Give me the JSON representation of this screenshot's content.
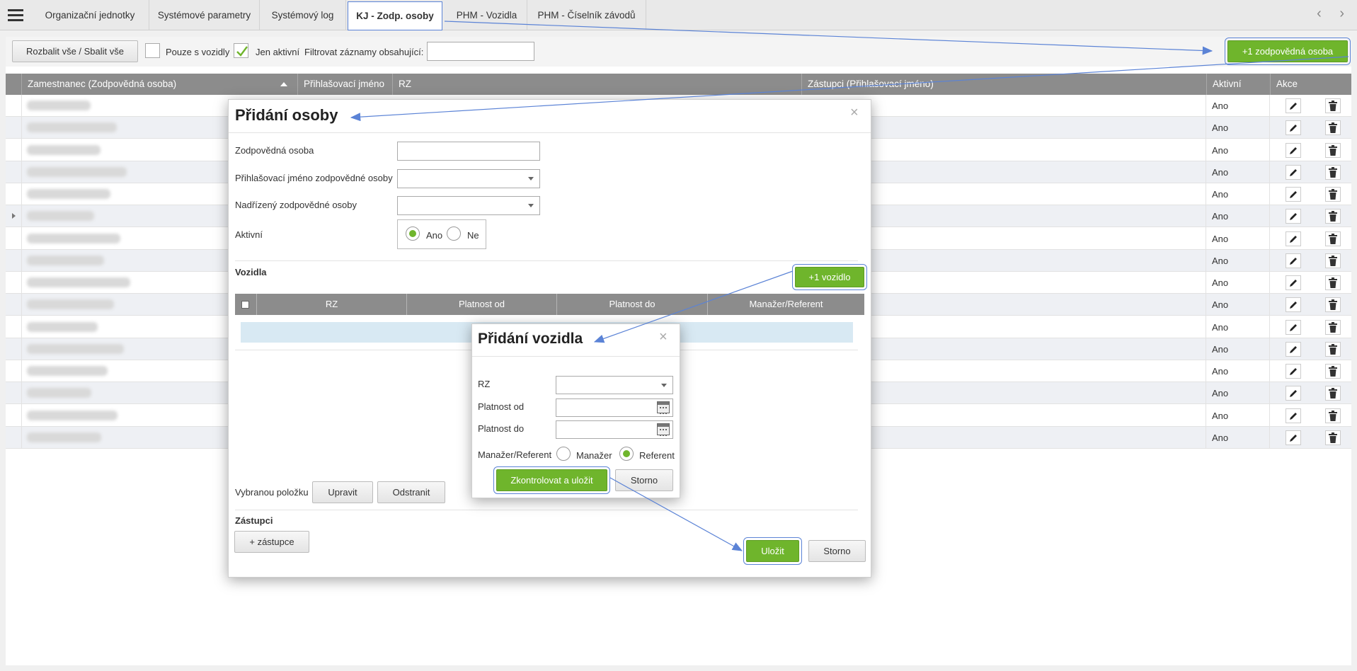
{
  "tabs": [
    {
      "label": "Organizační jednotky"
    },
    {
      "label": "Systémové parametry"
    },
    {
      "label": "Systémový log"
    },
    {
      "label": "KJ - Zodp. osoby"
    },
    {
      "label": "PHM - Vozidla"
    },
    {
      "label": "PHM - Číselník závodů"
    }
  ],
  "nav_arrows": "‹ ›",
  "toolbar": {
    "expand_label": "Rozbalit vše / Sbalit vše",
    "only_vehicles_label": "Pouze s vozidly",
    "only_active_label": "Jen aktivní",
    "filter_label": "Filtrovat záznamy obsahující:",
    "filter_value": "",
    "add_person_label": "+1 zodpovědná osoba"
  },
  "grid": {
    "columns": [
      "Zamestnanec (Zodpovědná osoba)",
      "Přihlašovací jméno",
      "RZ",
      "Zástupci (Přihlašovací jméno)",
      "Aktivní",
      "Akce"
    ],
    "rows": [
      {
        "active": "Ano"
      },
      {
        "active": "Ano"
      },
      {
        "active": "Ano"
      },
      {
        "active": "Ano"
      },
      {
        "active": "Ano"
      },
      {
        "active": "Ano"
      },
      {
        "active": "Ano"
      },
      {
        "active": "Ano"
      },
      {
        "active": "Ano"
      },
      {
        "active": "Ano"
      },
      {
        "active": "Ano"
      },
      {
        "active": "Ano"
      },
      {
        "active": "Ano"
      },
      {
        "active": "Ano"
      },
      {
        "active": "Ano"
      },
      {
        "active": "Ano"
      }
    ]
  },
  "person_dialog": {
    "title": "Přidání osoby",
    "close": "×",
    "responsible_label": "Zodpovědná osoba",
    "login_label": "Přihlašovací jméno zodpovědné osoby",
    "superior_label": "Nadřízený zodpovědné osoby",
    "active_label": "Aktivní",
    "yes_label": "Ano",
    "no_label": "Ne",
    "vehicles_label": "Vozidla",
    "add_vehicle_label": "+1 vozidlo",
    "vehicle_columns": [
      "RZ",
      "Platnost od",
      "Platnost do",
      "Manažer/Referent"
    ],
    "selected_item_label": "Vybranou položku",
    "edit_label": "Upravit",
    "remove_label": "Odstranit",
    "deputies_label": "Zástupci",
    "add_deputy_label": "+ zástupce",
    "save_label": "Uložit",
    "cancel_label": "Storno"
  },
  "vehicle_dialog": {
    "title": "Přidání vozidla",
    "close": "×",
    "rz_label": "RZ",
    "valid_from_label": "Platnost od",
    "valid_to_label": "Platnost do",
    "role_label": "Manažer/Referent",
    "manager_label": "Manažer",
    "referent_label": "Referent",
    "check_save_label": "Zkontrolovat a uložit",
    "cancel_label": "Storno"
  },
  "colors": {
    "accent": "#6fb52c",
    "header": "#8c8c8c",
    "annotation": "#5b83d6"
  },
  "icons": [
    "hamburger-menu-icon",
    "pencil-icon",
    "trash-icon",
    "calendar-icon",
    "chevron-down-icon",
    "close-icon",
    "expand-row-icon",
    "sort-up-icon"
  ]
}
